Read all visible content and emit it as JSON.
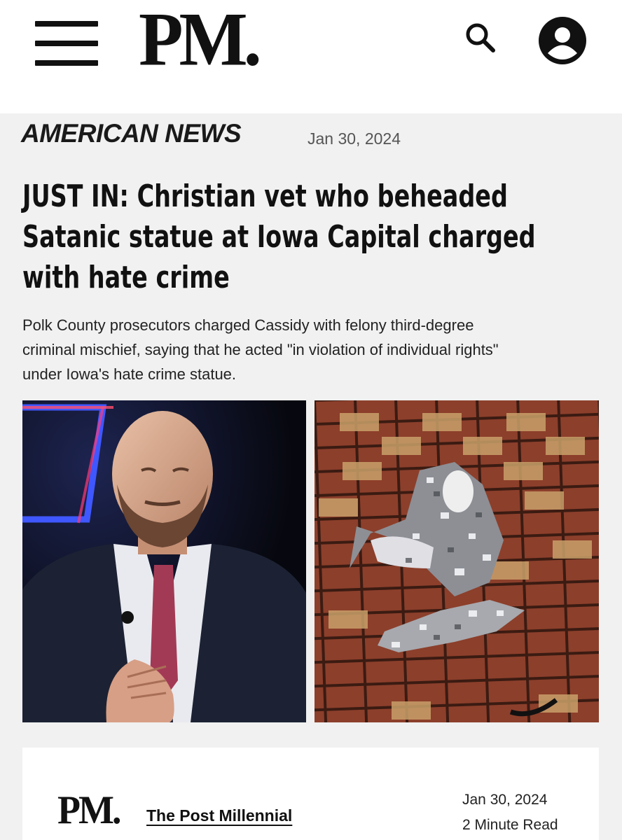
{
  "header": {
    "logo": "PM.",
    "menu_icon": "hamburger-menu-icon",
    "search_icon": "search-icon",
    "account_icon": "user-account-icon"
  },
  "article": {
    "category": "AMERICAN NEWS",
    "date": "Jan 30, 2024",
    "headline_lines": [
      "JUST IN: Christian vet who beheaded",
      "Satanic statue at Iowa Capital charged",
      "with hate crime"
    ],
    "summary_lines": [
      "Polk County prosecutors charged Cassidy with felony third-degree",
      "criminal mischief, saying that he acted \"in violation of individual rights\"",
      "under Iowa's hate crime statue."
    ]
  },
  "byline": {
    "logo": "PM.",
    "author": "The Post Millennial",
    "date": "Jan 30, 2024",
    "read_time": "2 Minute Read"
  },
  "colors": {
    "background": "#f1f1f1",
    "header_bg": "#ffffff",
    "text": "#111111",
    "muted": "#555555"
  }
}
